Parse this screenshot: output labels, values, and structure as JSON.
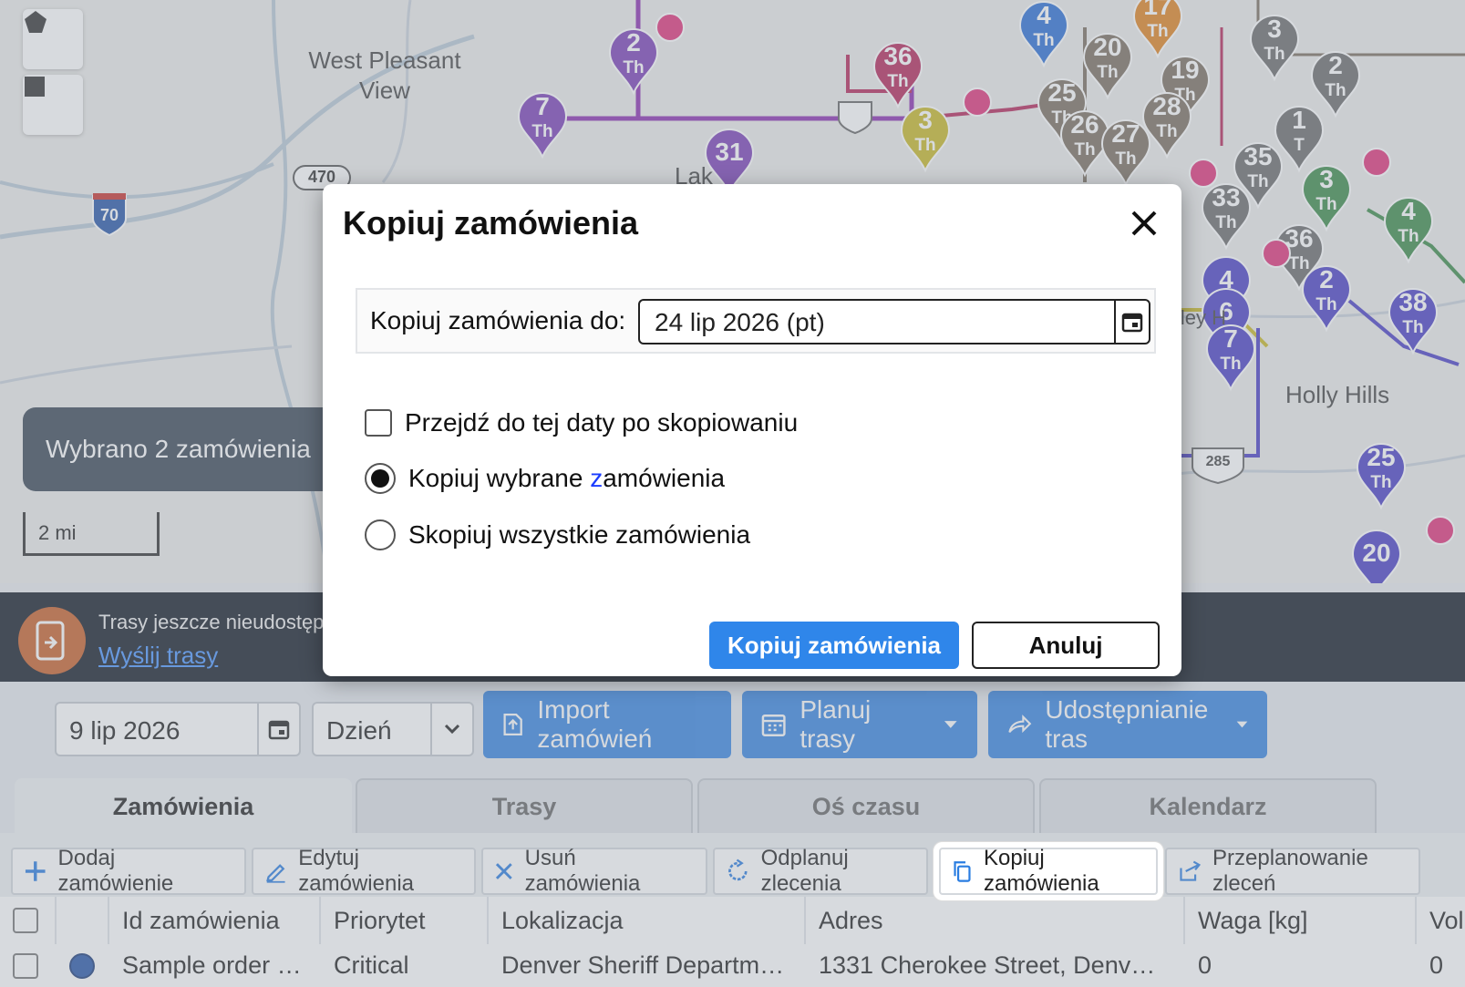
{
  "map": {
    "labels": {
      "west_pleasant_view": "West Pleasant\nView",
      "holly_hills": "Holly Hills",
      "valley": "lley H",
      "lake": "Lak"
    },
    "highways": {
      "i70": "70",
      "h470": "470",
      "h285": "285"
    },
    "scale_label": "2 mi",
    "selection_toast": "Wybrano 2 zamówienia",
    "pins": [
      {
        "num": "2",
        "sub": "Th",
        "color": "#7b3fb6"
      },
      {
        "num": "7",
        "sub": "Th",
        "color": "#7b3fb6"
      },
      {
        "num": "31",
        "sub": "",
        "color": "#7b3fb6"
      },
      {
        "num": "36",
        "sub": "Th",
        "color": "#b5275a"
      },
      {
        "num": "3",
        "sub": "Th",
        "color": "#c9b826"
      },
      {
        "num": "4",
        "sub": "Th",
        "color": "#2b6fd6"
      },
      {
        "num": "17",
        "sub": "Th",
        "color": "#e08320"
      },
      {
        "num": "20",
        "sub": "Th",
        "color": "#7b6f5f"
      },
      {
        "num": "19",
        "sub": "Th",
        "color": "#7b6f5f"
      },
      {
        "num": "25",
        "sub": "Th",
        "color": "#7b6f5f"
      },
      {
        "num": "26",
        "sub": "Th",
        "color": "#7b6f5f"
      },
      {
        "num": "27",
        "sub": "Th",
        "color": "#7b6f5f"
      },
      {
        "num": "28",
        "sub": "Th",
        "color": "#7b6f5f"
      },
      {
        "num": "3",
        "sub": "Th",
        "color": "#6b6b6b"
      },
      {
        "num": "2",
        "sub": "Th",
        "color": "#6b6b6b"
      },
      {
        "num": "1",
        "sub": "T",
        "color": "#6b6b6b"
      },
      {
        "num": "35",
        "sub": "Th",
        "color": "#6b6b6b"
      },
      {
        "num": "33",
        "sub": "Th",
        "color": "#6b6b6b"
      },
      {
        "num": "36",
        "sub": "Th",
        "color": "#6b6b6b"
      },
      {
        "num": "3",
        "sub": "Th",
        "color": "#3d8b4a"
      },
      {
        "num": "4",
        "sub": "Th",
        "color": "#3d8b4a"
      },
      {
        "num": "4",
        "sub": "",
        "color": "#4b3fc6"
      },
      {
        "num": "6",
        "sub": "",
        "color": "#4b3fc6"
      },
      {
        "num": "7",
        "sub": "Th",
        "color": "#4b3fc6"
      },
      {
        "num": "2",
        "sub": "Th",
        "color": "#4b3fc6"
      },
      {
        "num": "38",
        "sub": "Th",
        "color": "#4b3fc6"
      },
      {
        "num": "25",
        "sub": "Th",
        "color": "#4b3fc6"
      },
      {
        "num": "20",
        "sub": "",
        "color": "#4b3fc6"
      }
    ]
  },
  "banner": {
    "text": "Trasy jeszcze nieudostępnione",
    "link": "Wyślij trasy"
  },
  "toolbar": {
    "date": "9 lip 2026",
    "view": "Dzień",
    "import_label": "Import zamówień",
    "plan_label": "Planuj trasy",
    "share_label": "Udostępnianie tras"
  },
  "tabs": [
    "Zamówienia",
    "Trasy",
    "Oś czasu",
    "Kalendarz"
  ],
  "actions": {
    "add": "Dodaj zamówienie",
    "edit": "Edytuj zamówienia",
    "delete": "Usuń zamówienia",
    "unplan": "Odplanuj zlecenia",
    "copy": "Kopiuj zamówienia",
    "replan": "Przeplanowanie zleceń"
  },
  "table": {
    "headers": [
      "Id zamówienia",
      "Priorytet",
      "Lokalizacja",
      "Adres",
      "Waga [kg]",
      "Vol"
    ],
    "rows": [
      {
        "id": "Sample order …",
        "priority": "Critical",
        "location": "Denver Sheriff Departm…",
        "address": "1331 Cherokee Street, Denv…",
        "weight": "0",
        "vol": "0"
      }
    ]
  },
  "modal": {
    "title": "Kopiuj zamówienia",
    "date_label": "Kopiuj zamówienia do:",
    "date_value": "24 lip 2026 (pt)",
    "checkbox_label": "Przejdź do tej daty po skopiowaniu",
    "radio_selected_pre": "Kopiuj wybrane ",
    "radio_selected_z": "z",
    "radio_selected_post": "amówienia",
    "radio_all": "Skopiuj wszystkie zamówienia",
    "confirm": "Kopiuj zamówienia",
    "cancel": "Anuluj"
  },
  "colors": {
    "accent": "#2f86ea",
    "banner_bg": "#141c28",
    "highlight_blue": "#1a3cff"
  }
}
